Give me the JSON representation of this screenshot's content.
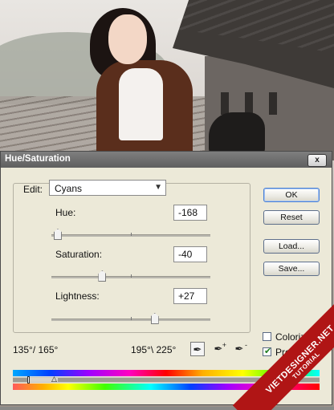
{
  "dialog": {
    "title": "Hue/Saturation",
    "close_label": "x"
  },
  "edit": {
    "label": "Edit:",
    "selected": "Cyans"
  },
  "adjustments": {
    "hue": {
      "label": "Hue:",
      "value": "-168",
      "slider_fraction": 0.02
    },
    "saturation": {
      "label": "Saturation:",
      "value": "-40",
      "slider_fraction": 0.3
    },
    "lightness": {
      "label": "Lightness:",
      "value": "+27",
      "slider_fraction": 0.63
    }
  },
  "buttons": {
    "ok": "OK",
    "reset": "Reset",
    "load": "Load...",
    "save": "Save..."
  },
  "options": {
    "colorize_label": "Colorize",
    "colorize_checked": false,
    "preview_label": "Preview",
    "preview_checked": true
  },
  "range": {
    "left": "135°/ 165°",
    "right": "195°\\ 225°"
  },
  "icons": {
    "eyedropper": "eyedropper-icon",
    "eyedropper_add": "eyedropper-plus-icon",
    "eyedropper_subtract": "eyedropper-minus-icon"
  },
  "watermark": {
    "line1": "VIETDESIGNER.NET",
    "line2": "TUTORIAL"
  }
}
